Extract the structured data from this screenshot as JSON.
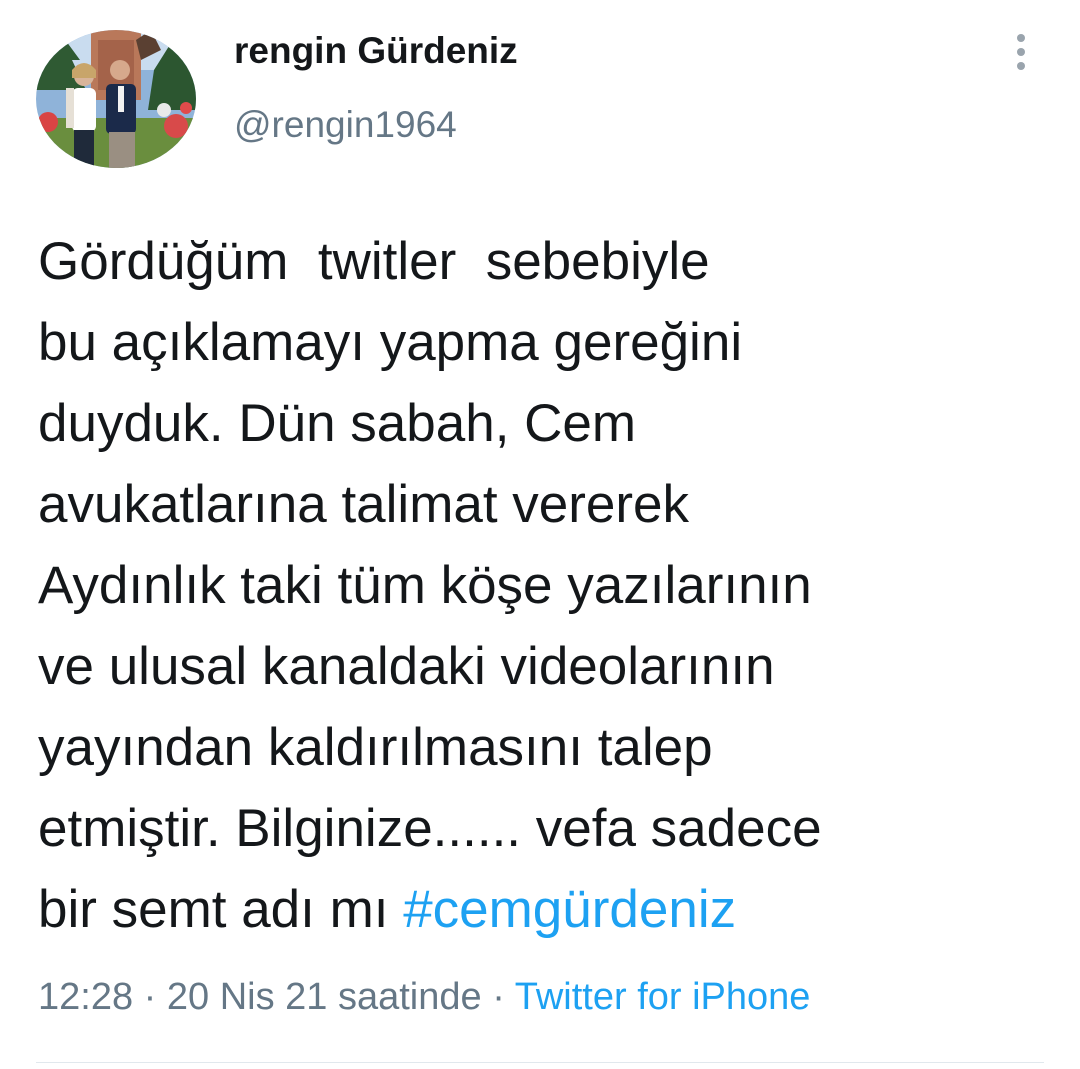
{
  "user": {
    "display_name": "rengin Gürdeniz",
    "handle": "@rengin1964",
    "avatar_icon": "profile-photo"
  },
  "menu": {
    "icon": "more-vertical-icon"
  },
  "tweet": {
    "lines": [
      "Gördüğüm  twitler  sebebiyle",
      "bu açıklamayı yapma gereğini",
      "duyduk. Dün sabah, Cem",
      "avukatlarına talimat vererek",
      "Aydınlık taki tüm köşe yazılarının",
      "ve ulusal kanaldaki videolarının",
      "yayından kaldırılmasını talep",
      "etmiştir. Bilginize...... vefa sadece",
      "bir semt adı mı "
    ],
    "hashtag": "#cemgürdeniz"
  },
  "meta": {
    "time": "12:28",
    "separator": " · ",
    "date": "20 Nis 21 saatinde",
    "source": "Twitter for iPhone"
  },
  "colors": {
    "link": "#1da1f2",
    "secondary_text": "#657786",
    "primary_text": "#14171a"
  }
}
